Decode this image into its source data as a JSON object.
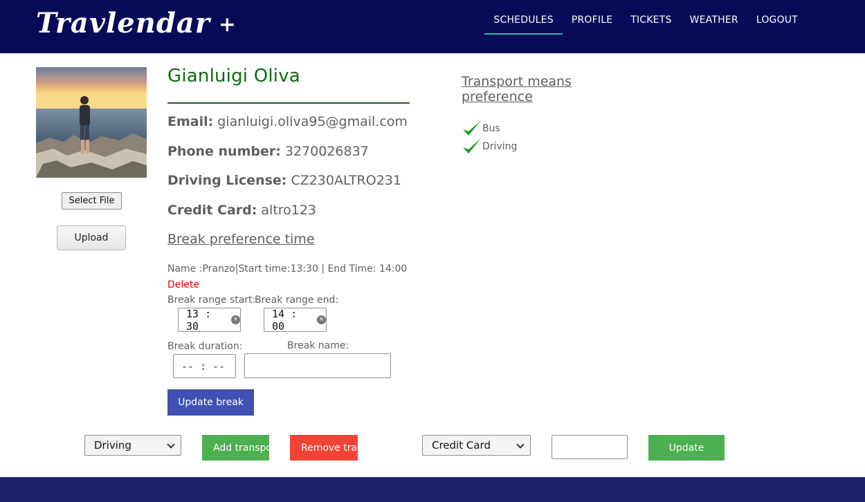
{
  "brand": {
    "name": "Travlendar",
    "plus": "+"
  },
  "nav": {
    "items": [
      "SCHEDULES",
      "PROFILE",
      "TICKETS",
      "WEATHER",
      "LOGOUT"
    ],
    "active": "SCHEDULES"
  },
  "avatar": {
    "select_file_label": "Select File",
    "upload_label": "Upload"
  },
  "profile": {
    "name": "Gianluigi Oliva",
    "email_label": "Email:",
    "email": "gianluigi.oliva95@gmail.com",
    "phone_label": "Phone number:",
    "phone": "3270026837",
    "license_label": "Driving License:",
    "license": "CZ230ALTRO231",
    "card_label": "Credit Card:",
    "card": "altro123"
  },
  "break": {
    "title": "Break preference time",
    "entry": "Name :Pranzo|Start time:13:30 | End Time: 14:00",
    "delete_label": "Delete",
    "range_start_label": "Break range start:",
    "range_end_label": "Break range end:",
    "range_start_value": "13 : 30",
    "range_end_value": "14 : 00",
    "duration_label": "Break duration:",
    "duration_value": "-- : --",
    "name_label": "Break name:",
    "name_value": "",
    "update_label": "Update break"
  },
  "transport": {
    "title": "Transport means preference",
    "means": [
      "Bus",
      "Driving"
    ]
  },
  "bottom": {
    "transport_select": "Driving",
    "add_transport_label": "Add transport",
    "remove_transport_label": "Remove transport",
    "payment_select": "Credit Card",
    "payment_input": "",
    "update_label": "Update"
  },
  "colors": {
    "navbar": "#070b57",
    "active_underline": "#2bbbad",
    "name_green": "#0d6b0d",
    "primary_blue": "#3f51b5",
    "button_green": "#4caf50",
    "button_red": "#f44336",
    "delete_red": "#e00000",
    "footer": "#1f1f6b"
  }
}
